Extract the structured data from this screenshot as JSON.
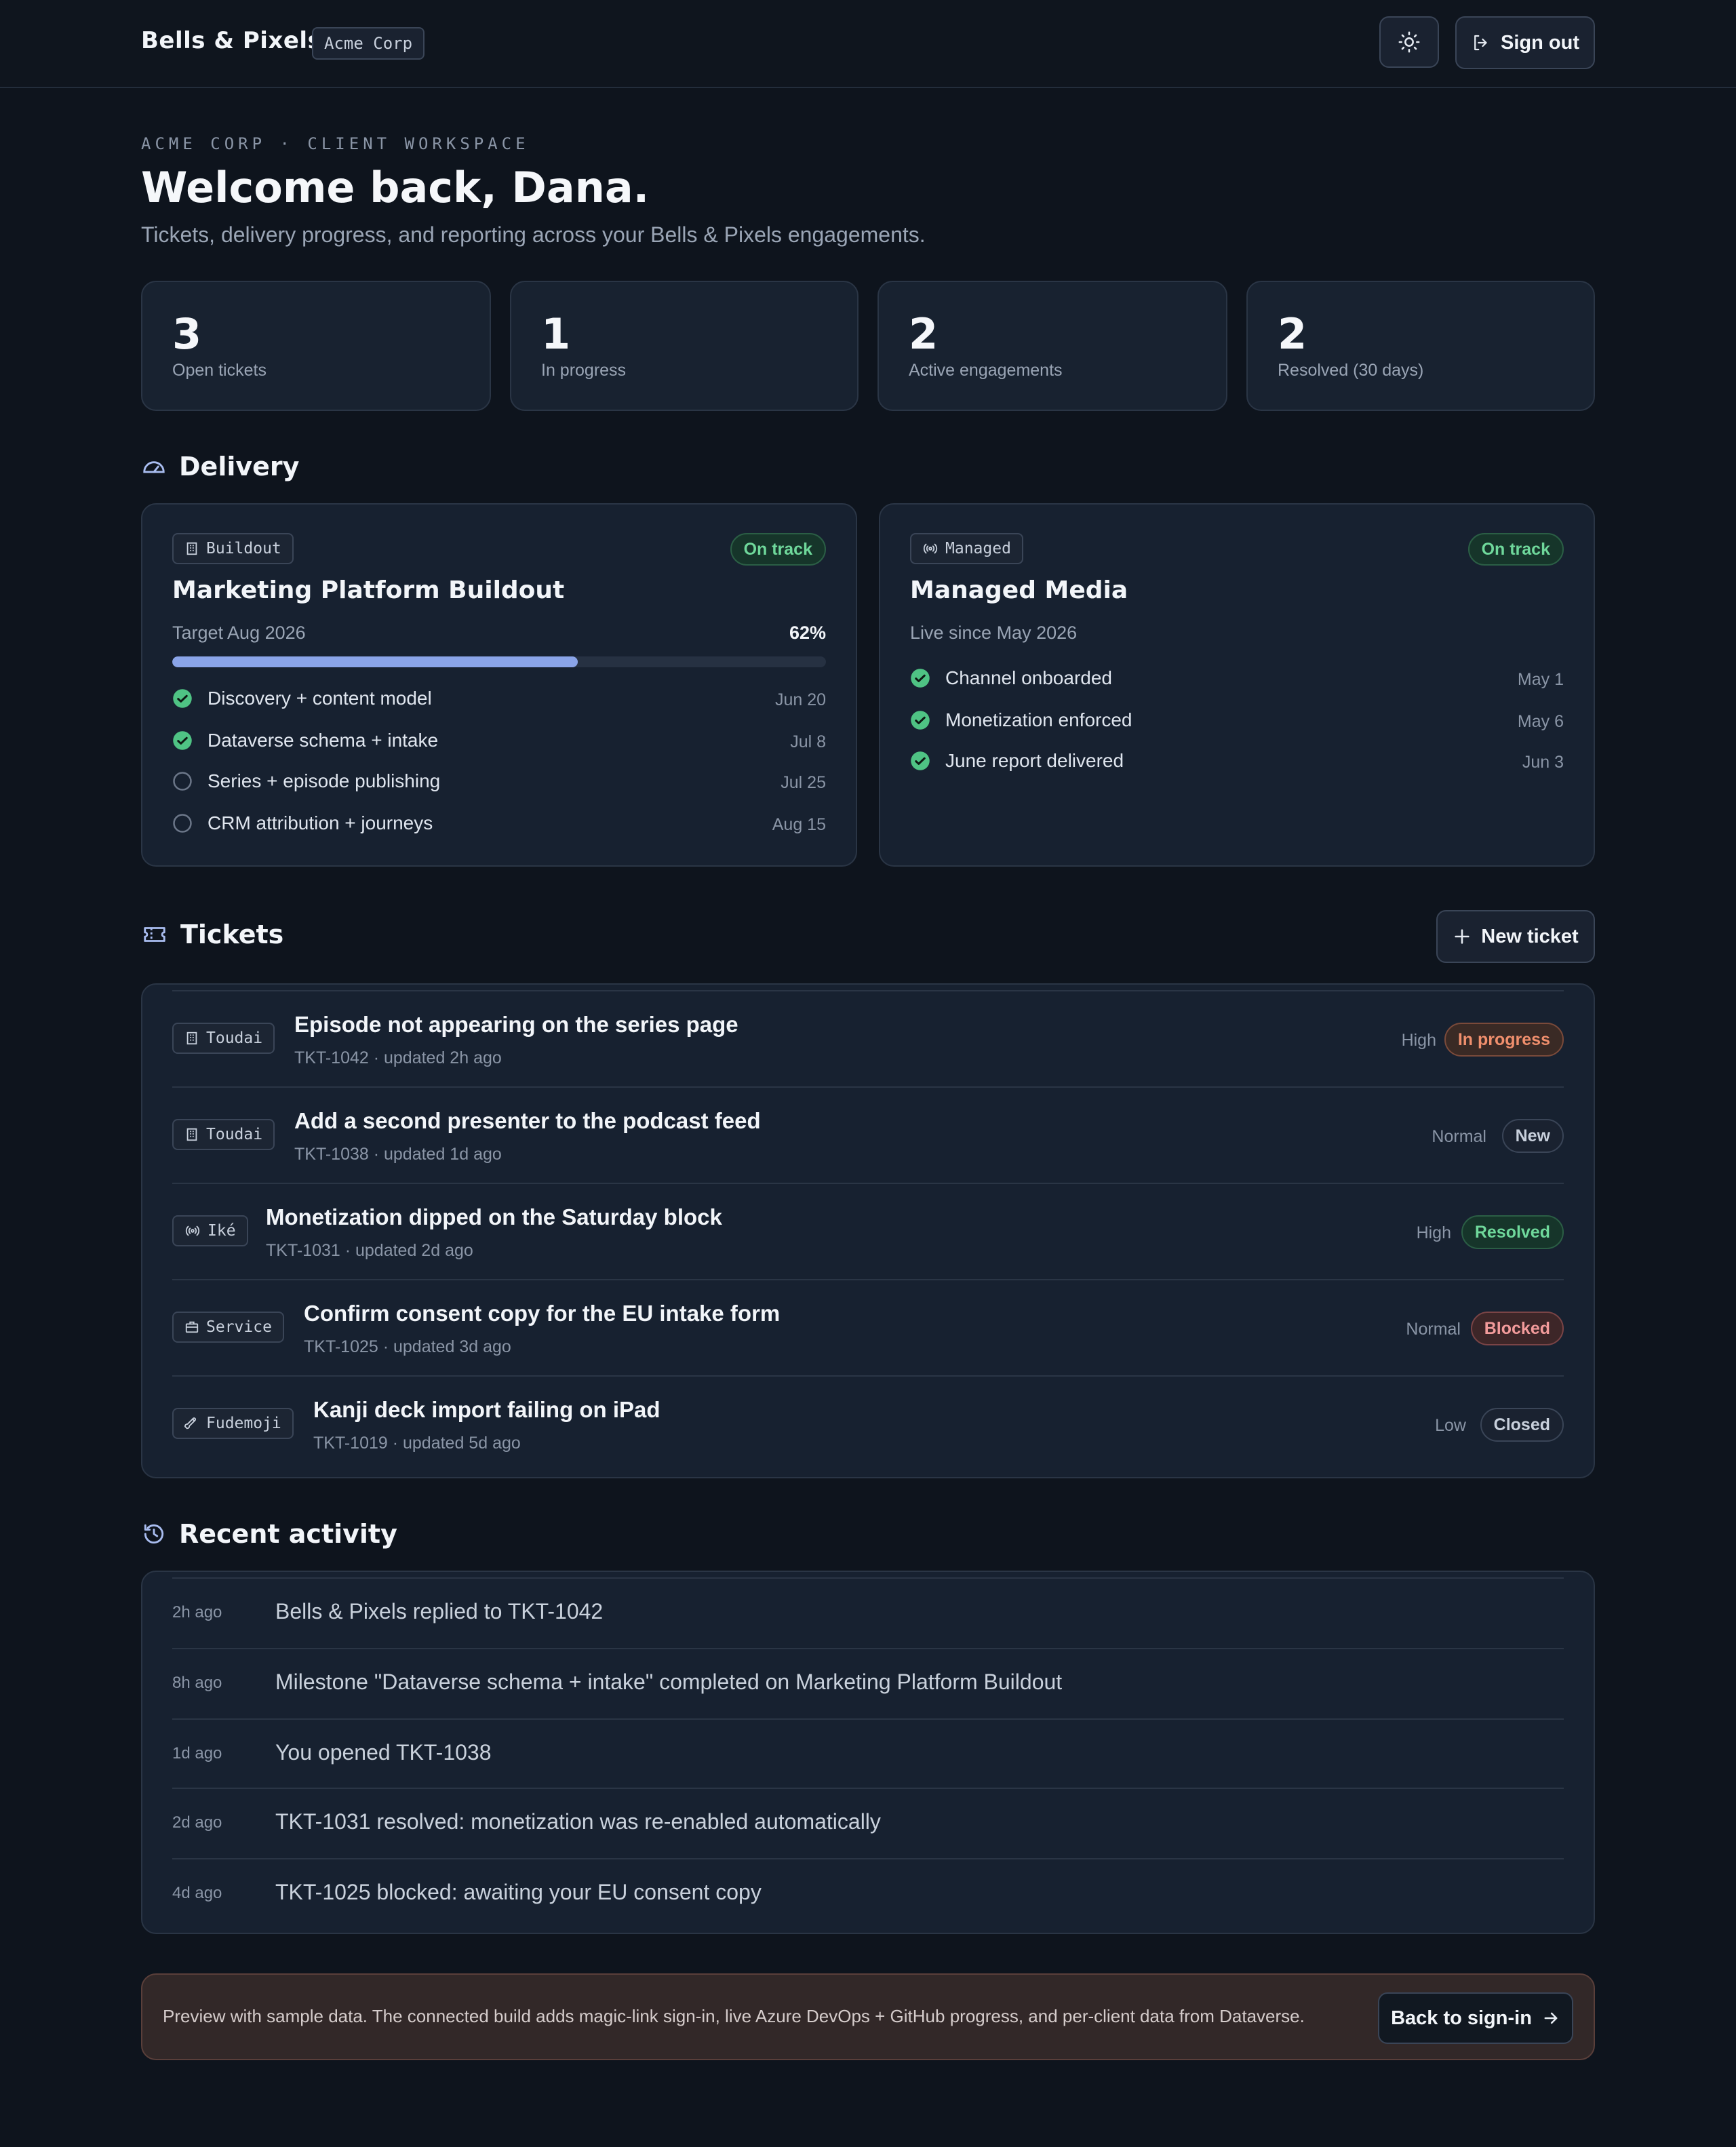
{
  "header": {
    "brand": "Bells & Pixels",
    "org_chip": "Acme Corp",
    "theme_icon": "sun-icon",
    "signout_label": "Sign out"
  },
  "intro": {
    "eyebrow": "ACME CORP · CLIENT WORKSPACE",
    "welcome": "Welcome back, Dana.",
    "subtitle": "Tickets, delivery progress, and reporting across your Bells & Pixels engagements."
  },
  "stats": [
    {
      "value": "3",
      "label": "Open tickets"
    },
    {
      "value": "1",
      "label": "In progress"
    },
    {
      "value": "2",
      "label": "Active engagements"
    },
    {
      "value": "2",
      "label": "Resolved (30 days)"
    }
  ],
  "delivery": {
    "title": "Delivery",
    "cards": [
      {
        "tag": "Buildout",
        "tag_icon": "building-icon",
        "status": "On track",
        "title": "Marketing Platform Buildout",
        "subtitle": "Target Aug 2026",
        "progress_pct": 62,
        "progress_label": "62%",
        "milestones": [
          {
            "label": "Discovery + content model",
            "date": "Jun 20",
            "done": true
          },
          {
            "label": "Dataverse schema + intake",
            "date": "Jul 8",
            "done": true
          },
          {
            "label": "Series + episode publishing",
            "date": "Jul 25",
            "done": false
          },
          {
            "label": "CRM attribution + journeys",
            "date": "Aug 15",
            "done": false
          }
        ]
      },
      {
        "tag": "Managed",
        "tag_icon": "broadcast-icon",
        "status": "On track",
        "title": "Managed Media",
        "subtitle": "Live since May 2026",
        "milestones": [
          {
            "label": "Channel onboarded",
            "date": "May 1",
            "done": true
          },
          {
            "label": "Monetization enforced",
            "date": "May 6",
            "done": true
          },
          {
            "label": "June report delivered",
            "date": "Jun 3",
            "done": true
          }
        ]
      }
    ]
  },
  "tickets": {
    "title": "Tickets",
    "new_label": "New ticket",
    "rows": [
      {
        "tag": "Toudai",
        "tag_icon": "building-icon",
        "title": "Episode not appearing on the series page",
        "meta": "TKT-1042 · updated 2h ago",
        "priority": "High",
        "status": "In progress"
      },
      {
        "tag": "Toudai",
        "tag_icon": "building-icon",
        "title": "Add a second presenter to the podcast feed",
        "meta": "TKT-1038 · updated 1d ago",
        "priority": "Normal",
        "status": "New"
      },
      {
        "tag": "Iké",
        "tag_icon": "broadcast-icon",
        "title": "Monetization dipped on the Saturday block",
        "meta": "TKT-1031 · updated 2d ago",
        "priority": "High",
        "status": "Resolved"
      },
      {
        "tag": "Service",
        "tag_icon": "briefcase-icon",
        "title": "Confirm consent copy for the EU intake form",
        "meta": "TKT-1025 · updated 3d ago",
        "priority": "Normal",
        "status": "Blocked"
      },
      {
        "tag": "Fudemoji",
        "tag_icon": "brush-icon",
        "title": "Kanji deck import failing on iPad",
        "meta": "TKT-1019 · updated 5d ago",
        "priority": "Low",
        "status": "Closed"
      }
    ]
  },
  "activity": {
    "title": "Recent activity",
    "rows": [
      {
        "when": "2h ago",
        "what": "Bells & Pixels replied to TKT-1042"
      },
      {
        "when": "8h ago",
        "what": "Milestone \"Dataverse schema + intake\" completed on Marketing Platform Buildout"
      },
      {
        "when": "1d ago",
        "what": "You opened TKT-1038"
      },
      {
        "when": "2d ago",
        "what": "TKT-1031 resolved: monetization was re-enabled automatically"
      },
      {
        "when": "4d ago",
        "what": "TKT-1025 blocked: awaiting your EU consent copy"
      }
    ]
  },
  "banner": {
    "text": "Preview with sample data. The connected build adds magic-link sign-in, live Azure DevOps + GitHub progress, and per-client data from Dataverse.",
    "button_label": "Back to sign-in"
  },
  "colors": {
    "background": "#0e141d",
    "card": "#172130",
    "accent_progress": "#8aa4e8",
    "success": "#6fd89b",
    "in_progress": "#f08f6d",
    "blocked": "#f29b9b"
  }
}
